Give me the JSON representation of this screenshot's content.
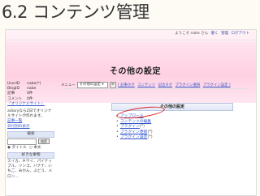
{
  "slide": {
    "title": "6.2 コンテンツ管理"
  },
  "header": {
    "user_message": "ようこそ nabe さん",
    "links": [
      "書く",
      "管理",
      "ログアウト"
    ]
  },
  "page": {
    "title": "その他の設定"
  },
  "sidebar": {
    "stats": [
      {
        "key": "UserID",
        "value": "nabe(*)"
      },
      {
        "key": "BlogID",
        "value": "nabe"
      },
      {
        "key": "記事",
        "value": "0件"
      },
      {
        "key": "コメント",
        "value": "0件"
      }
    ],
    "original_site_link": "『オリジナルサイト』",
    "note": "adiaryならZ日でオリジナルサイトが作れます。",
    "article_list_link": "記事一覧",
    "date_archive_link": "日付別の表示",
    "search_title": "検索",
    "search_button": "検索",
    "search_options": [
      "タイトル",
      "本文"
    ],
    "favorites_title": "好きな果物",
    "favorites_text": "スイカ、キウイ、パイナップル、リンゴ、バナナ、いちご、みかん、ぶどう、メロン..."
  },
  "breadcrumb": {
    "menu_label": "メニュー",
    "select_value": "その他の設定",
    "go_label": "≫",
    "links": [
      "[ 記事タグ",
      "コンテンツ",
      "記念タグ",
      "プラグイン選択",
      "プラグイン設定 ]"
    ]
  },
  "panel": {
    "title": "その他の設定",
    "items": [
      {
        "label": "アップロード",
        "suffix": ""
      },
      {
        "label": "コンテンツの編集",
        "suffix": ""
      },
      {
        "label": "プラグイン",
        "suffix": "(*)"
      },
      {
        "label": "プラグイン更新",
        "suffix": "(*)"
      },
      {
        "label": "プラグイン設定",
        "suffix": "(*)"
      }
    ]
  }
}
